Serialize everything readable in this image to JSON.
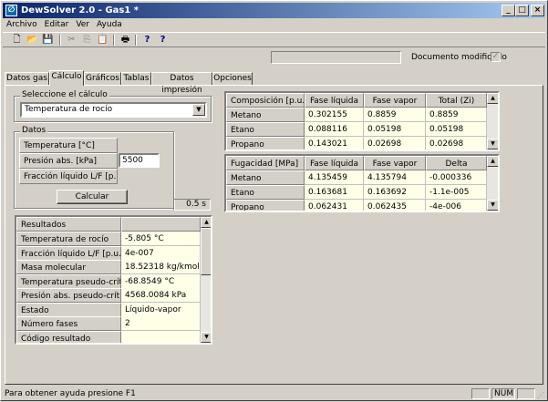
{
  "window": {
    "title": "DewSolver 2.0 - Gas1 *",
    "min": "_",
    "max": "□",
    "close": "×"
  },
  "menu": [
    "Archivo",
    "Editar",
    "Ver",
    "Ayuda"
  ],
  "toolbar": {
    "icons": [
      "new-icon",
      "open-icon",
      "save-icon",
      "cut-icon",
      "copy-icon",
      "paste-icon",
      "print-icon",
      "help-icon",
      "context-help-icon"
    ],
    "glyphs": [
      "🗋",
      "📂",
      "💾",
      "✂",
      "⎘",
      "📋",
      "🖶",
      "?",
      "?"
    ]
  },
  "doc_status": {
    "label": "Documento modificado",
    "checked": true
  },
  "tabs": [
    "Datos gas",
    "Cálculo",
    "Gráficos",
    "Tablas",
    "Datos impresión",
    "Opciones"
  ],
  "active_tab": 1,
  "calc_select": {
    "label": "Seleccione el cálculo",
    "value": "Temperatura de rocío"
  },
  "datos": {
    "label": "Datos",
    "rows": [
      {
        "label": "Temperatura  [°C]",
        "value": ""
      },
      {
        "label": "Presión abs.  [kPa]",
        "value": "5500"
      },
      {
        "label": "Fracción líquido L/F  [p.u.]",
        "value": ""
      }
    ],
    "button": "Calcular",
    "time": "0.5  s"
  },
  "resultados": {
    "header": "Resultados",
    "rows": [
      [
        "Temperatura de rocío",
        "-5.805  °C"
      ],
      [
        "Fracción líquido L/F  [p.u.]",
        "4e-007"
      ],
      [
        "Masa molecular",
        "18.52318  kg/kmol"
      ],
      [
        "Temperatura pseudo-crítica",
        "-68.8549  °C"
      ],
      [
        "Presión abs. pseudo-crítica",
        "4568.0084  kPa"
      ],
      [
        "Estado",
        "Líquido-vapor"
      ],
      [
        "Número fases",
        "2"
      ],
      [
        "Código resultado",
        ""
      ]
    ]
  },
  "composicion": {
    "headers": [
      "Composición  [p.u.]",
      "Fase líquida",
      "Fase vapor",
      "Total (Zi)"
    ],
    "rows": [
      [
        "Metano",
        "0.302155",
        "0.8859",
        "0.8859"
      ],
      [
        "Etano",
        "0.088116",
        "0.05198",
        "0.05198"
      ],
      [
        "Propano",
        "0.143021",
        "0.02698",
        "0.02698"
      ]
    ]
  },
  "fugacidad": {
    "headers": [
      "Fugacidad  [MPa]",
      "Fase líquida",
      "Fase vapor",
      "Delta"
    ],
    "rows": [
      [
        "Metano",
        "4.135459",
        "4.135794",
        "-0.000336"
      ],
      [
        "Etano",
        "0.163681",
        "0.163692",
        "-1.1e-005"
      ],
      [
        "Propano",
        "0.062431",
        "0.062435",
        "-4e-006"
      ]
    ]
  },
  "statusbar": {
    "help": "Para obtener ayuda presione F1",
    "num": "NUM"
  }
}
